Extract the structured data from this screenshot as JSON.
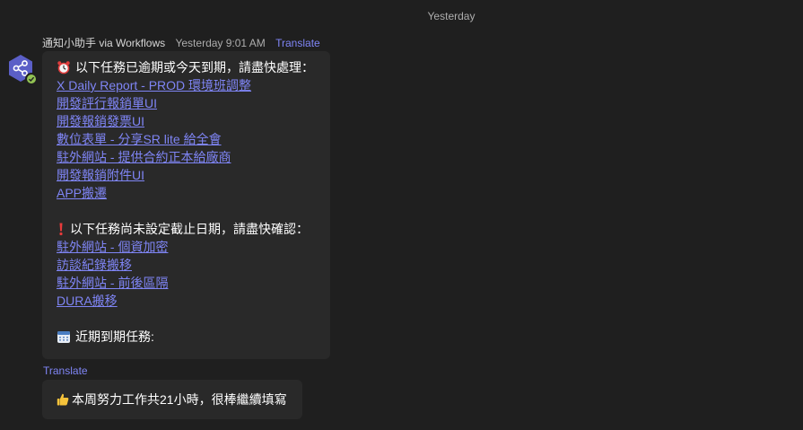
{
  "day_divider": "Yesterday",
  "message": {
    "sender": "通知小助手 via Workflows",
    "time": "Yesterday 9:01 AM",
    "translate_label": "Translate",
    "overdue": {
      "icon": "alarm-clock-icon",
      "heading": "以下任務已逾期或今天到期，請盡快處理：",
      "tasks": [
        "X Daily Report - PROD 環境班調整",
        "開發評行報銷單UI",
        "開發報銷發票UI",
        "數位表單 - 分享SR lite 給全會",
        "駐外網站 - 提供合約正本給廠商",
        "開發報銷附件UI",
        "APP搬遷"
      ]
    },
    "no_due": {
      "icon": "exclamation-icon",
      "heading": "以下任務尚未設定截止日期，請盡快確認：",
      "tasks": [
        "駐外網站 - 個資加密",
        "訪談紀錄搬移",
        "駐外網站 - 前後區隔",
        "DURA搬移"
      ]
    },
    "upcoming": {
      "icon": "calendar-icon",
      "heading": "近期到期任務:"
    }
  },
  "message2": {
    "translate_label": "Translate",
    "icon": "thumbs-up-icon",
    "text": "本周努力工作共21小時，很棒繼續填寫"
  },
  "colors": {
    "background": "#1f1f1f",
    "bubble": "#292929",
    "link": "#7f85f5",
    "avatar": "#5b5fc7",
    "presence": "#92c353"
  }
}
